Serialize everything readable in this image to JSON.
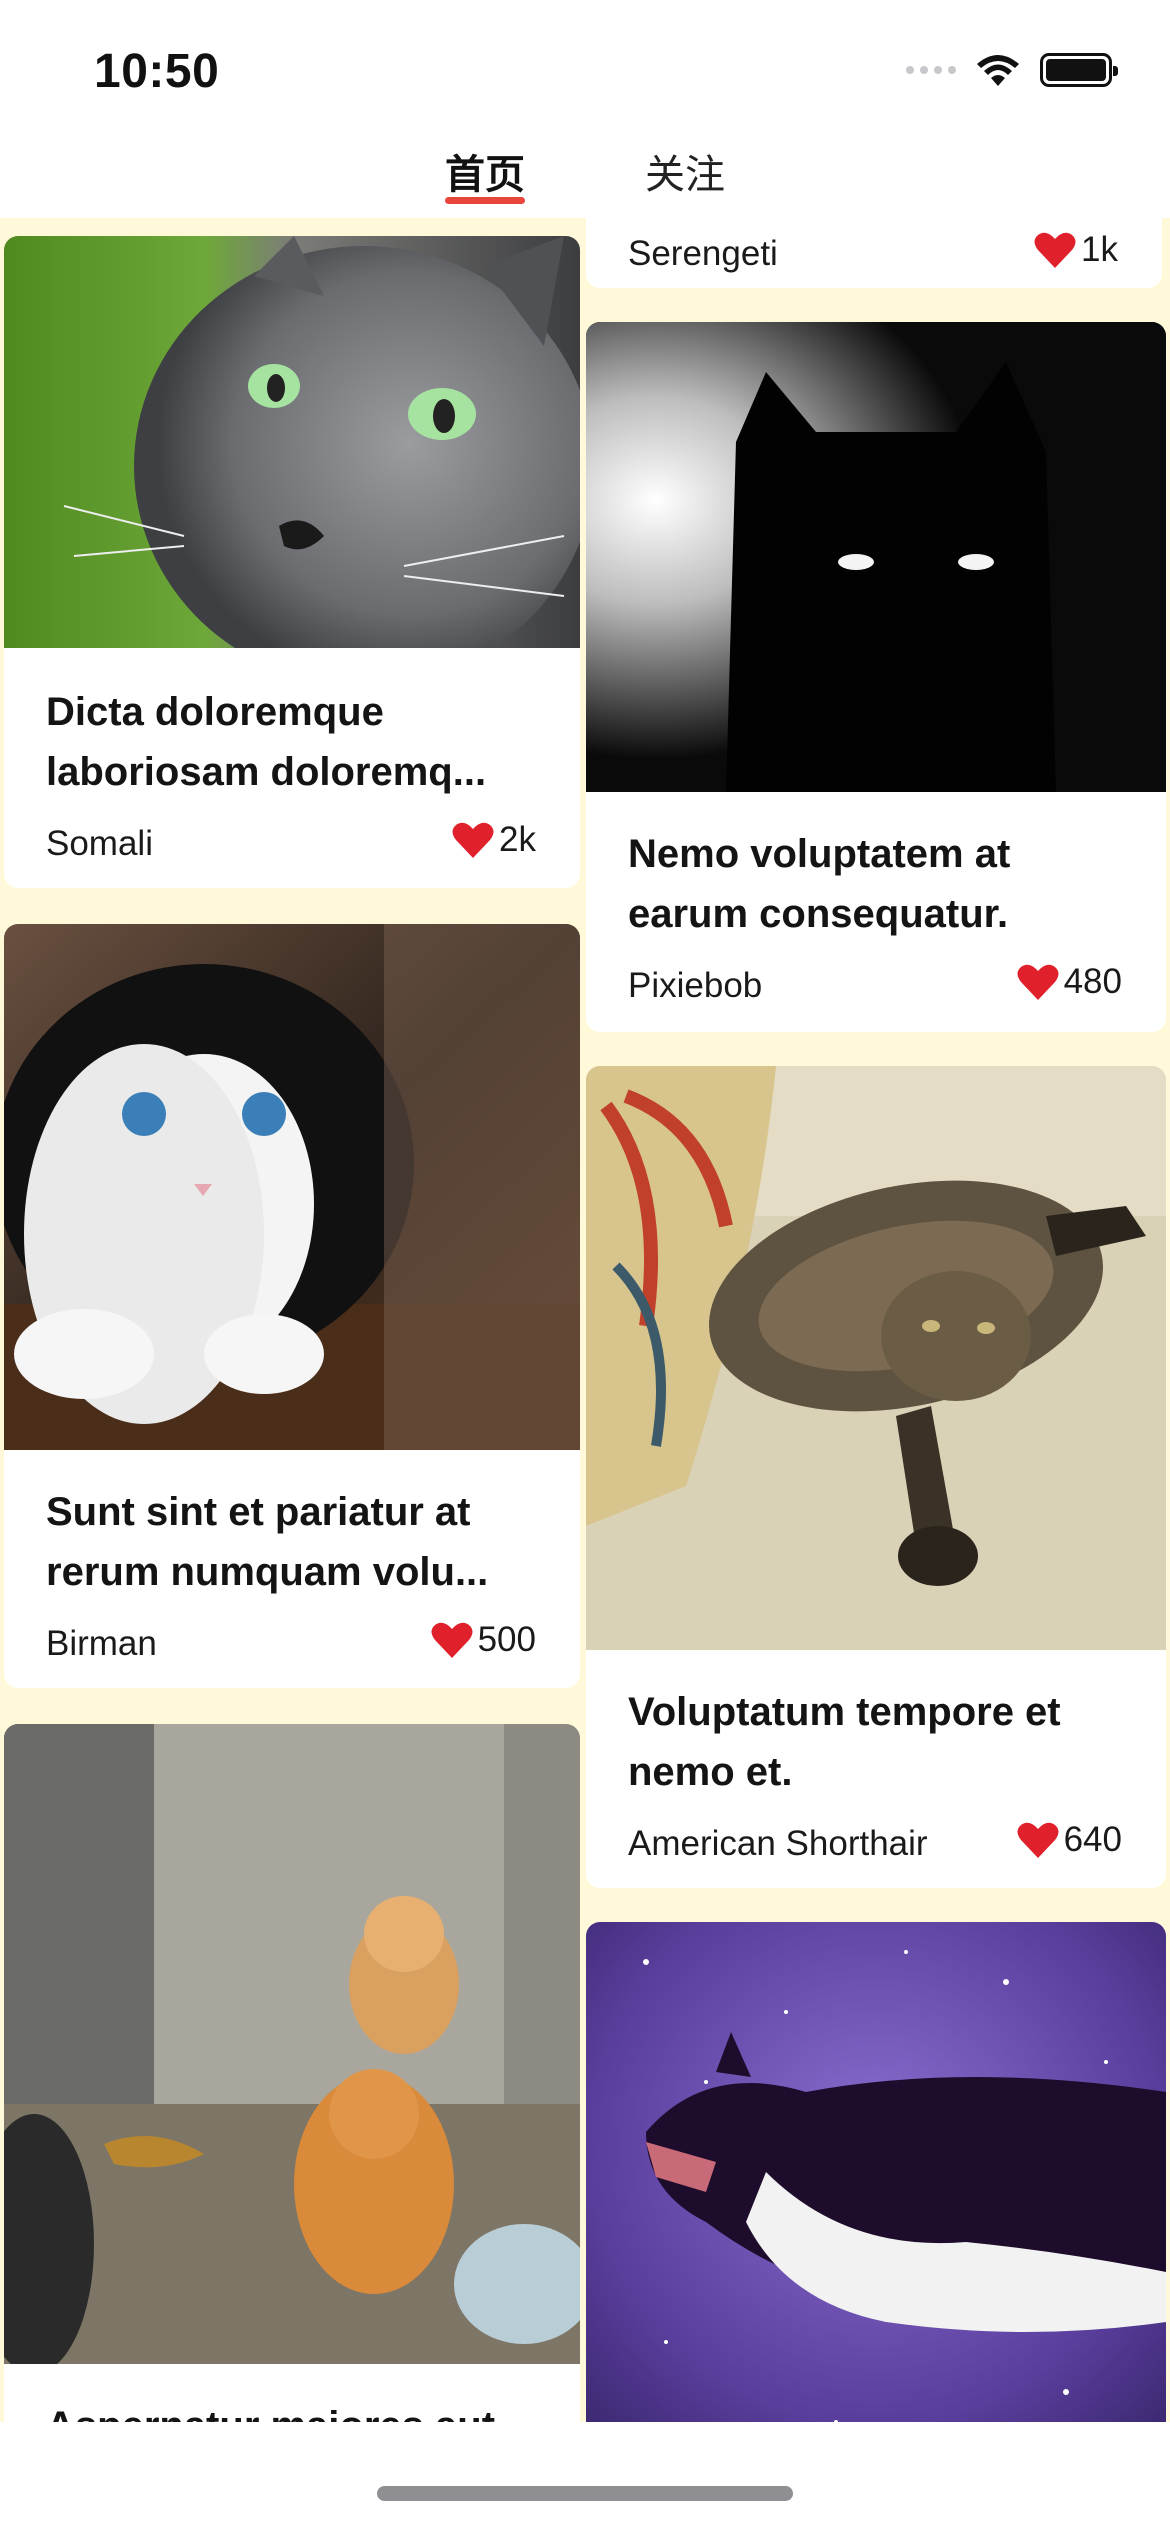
{
  "status_bar": {
    "time": "10:50"
  },
  "tabs": [
    {
      "label": "首页",
      "active": true
    },
    {
      "label": "关注",
      "active": false
    }
  ],
  "colors": {
    "accent": "#e8453c",
    "feed_background": "#fff9d9",
    "heart": "#e0202a"
  },
  "feed": {
    "left_column": [
      {
        "title": "Dicta doloremque laboriosam doloremq...",
        "author": "Somali",
        "likes": "2k",
        "image": "grey-cat-green-eyes"
      },
      {
        "title": "Sunt sint et pariatur at rerum numquam volu...",
        "author": "Birman",
        "likes": "500",
        "image": "black-white-kitten"
      },
      {
        "title": "Aspernatur maiores aut",
        "author": "",
        "likes": "",
        "image": "orange-kittens-outdoors"
      }
    ],
    "right_column": [
      {
        "title": "",
        "author": "Serengeti",
        "likes": "1k",
        "image": ""
      },
      {
        "title": "Nemo voluptatem at earum consequatur.",
        "author": "Pixiebob",
        "likes": "480",
        "image": "black-cat-dark"
      },
      {
        "title": "Voluptatum tempore et nemo et.",
        "author": "American Shorthair",
        "likes": "640",
        "image": "tabby-cat-on-bed"
      },
      {
        "title": "",
        "author": "",
        "likes": "",
        "image": "cat-in-space"
      }
    ]
  }
}
